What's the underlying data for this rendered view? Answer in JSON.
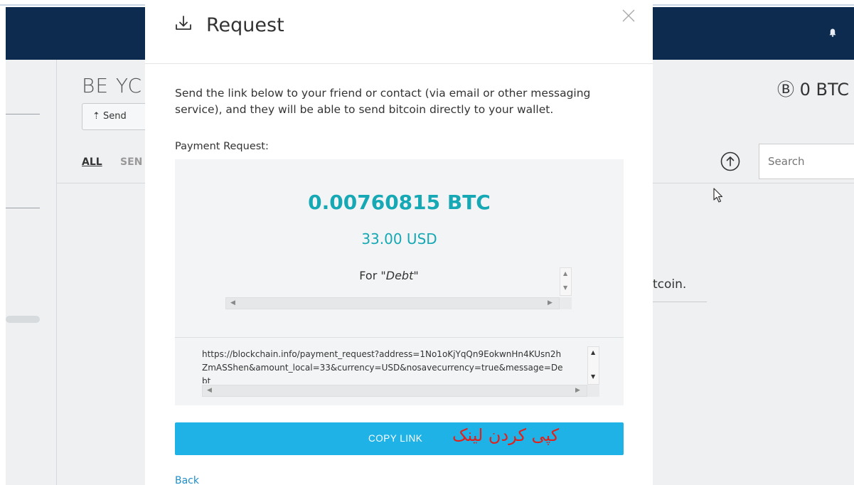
{
  "app": {
    "wallet_title": "BE YC",
    "send_button": "Send",
    "balance": "Ⓑ 0 BTC",
    "tabs": [
      {
        "label": "ALL"
      },
      {
        "label": "SEN"
      }
    ],
    "search": {
      "placeholder": "Search",
      "value": ""
    },
    "empty_state_fragment": "tcoin."
  },
  "modal": {
    "title": "Request",
    "intro": "Send the link below to your friend or contact (via email or other messaging service), and they will be able to send bitcoin directly to your wallet.",
    "payment_request_label": "Payment Request:",
    "btc_amount": "0.00760815 BTC",
    "usd_amount": "33.00 USD",
    "memo_prefix": "For",
    "memo_value": "\"Debt\"",
    "payment_link": "https://blockchain.info/payment_request?address=1No1oKjYqQn9EokwnHn4KUsn2hZmASShen&amount_local=33&currency=USD&nosavecurrency=true&message=Debt",
    "copy_button": "COPY LINK",
    "copy_annotation": "کپی کردن لینک",
    "back_link": "Back"
  },
  "colors": {
    "header_navy": "#0d2b4e",
    "accent_teal": "#16a8b4",
    "button_blue": "#1fb2e6",
    "annotation_red": "#e0211c",
    "link_blue": "#1f8fc9"
  },
  "icons": [
    "bell-icon",
    "download-icon",
    "close-icon",
    "export-icon",
    "cursor-icon",
    "send-icon"
  ]
}
